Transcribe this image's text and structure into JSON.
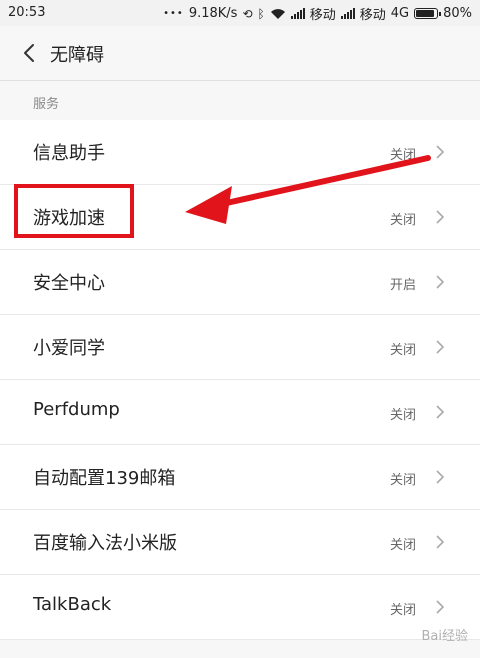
{
  "status_bar": {
    "time": "20:53",
    "dots": "•••",
    "speed": "9.18K/s",
    "carrier1": "移动",
    "carrier2": "移动",
    "network": "4G",
    "battery": "80%"
  },
  "header": {
    "title": "无障碍",
    "back_icon": "chevron-left-icon"
  },
  "section": {
    "title": "服务"
  },
  "services": [
    {
      "label": "信息助手",
      "status": "关闭"
    },
    {
      "label": "游戏加速",
      "status": "关闭"
    },
    {
      "label": "安全中心",
      "status": "开启"
    },
    {
      "label": "小爱同学",
      "status": "关闭"
    },
    {
      "label": "Perfdump",
      "status": "关闭"
    },
    {
      "label": "自动配置139邮箱",
      "status": "关闭"
    },
    {
      "label": "百度输入法小米版",
      "status": "关闭"
    },
    {
      "label": "TalkBack",
      "status": "关闭"
    }
  ],
  "annotation": {
    "color": "#e0141a"
  }
}
